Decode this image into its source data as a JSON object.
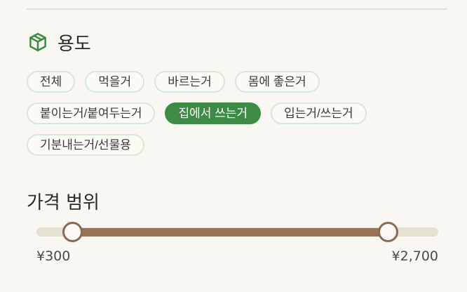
{
  "purpose_section": {
    "icon": "box-icon",
    "title": "용도",
    "chips": [
      {
        "label": "전체",
        "active": false
      },
      {
        "label": "먹을거",
        "active": false
      },
      {
        "label": "바르는거",
        "active": false
      },
      {
        "label": "몸에 좋은거",
        "active": false
      },
      {
        "label": "붙이는거/붙여두는거",
        "active": false
      },
      {
        "label": "집에서 쓰는거",
        "active": true
      },
      {
        "label": "입는거/쓰는거",
        "active": false
      },
      {
        "label": "기분내는거/선물용",
        "active": false
      }
    ]
  },
  "price_range": {
    "title": "가격 범위",
    "min_label": "¥300",
    "max_label": "¥2,700",
    "selected_min": 300,
    "selected_max": 2700
  },
  "colors": {
    "accent_green": "#3d8c45",
    "slider_fill": "#9a7255",
    "slider_track": "#e6e0d3"
  }
}
